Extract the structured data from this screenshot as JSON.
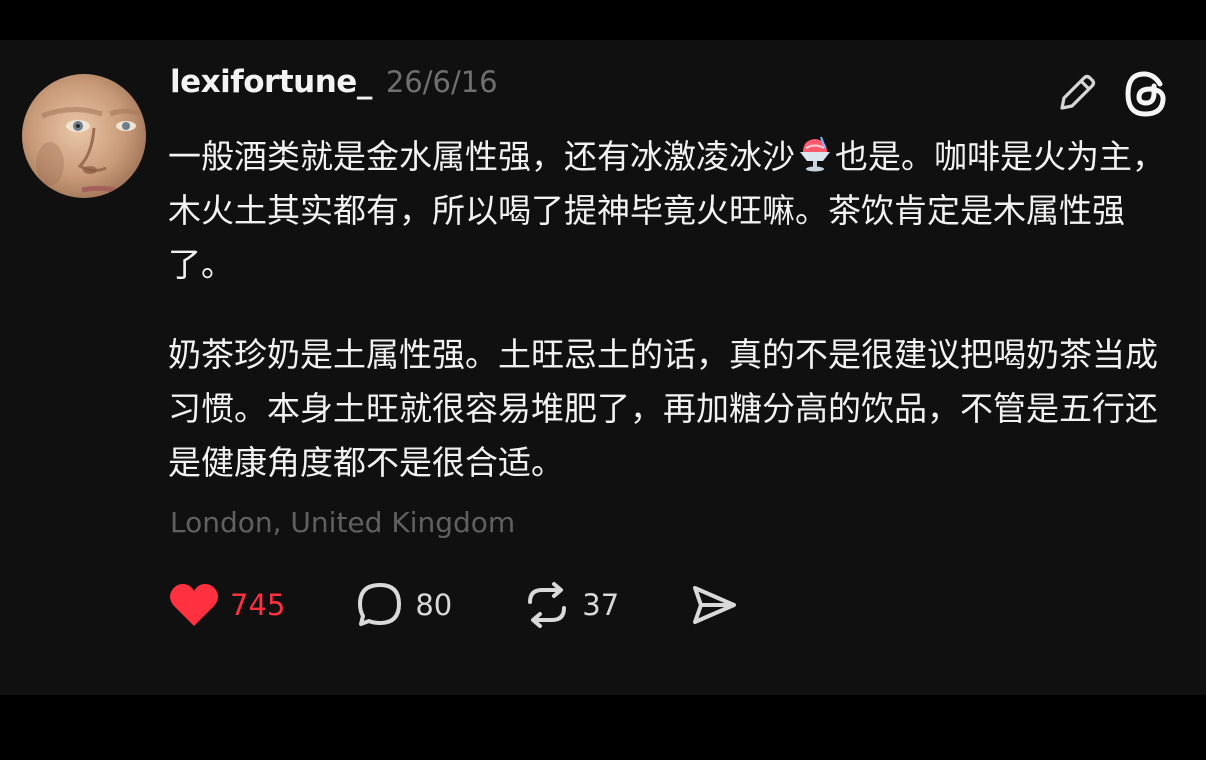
{
  "post": {
    "username": "lexifortune_",
    "timestamp": "26/6/16",
    "paragraph1_part1": "一般酒类就是金水属性强，还有冰激凌冰沙",
    "emoji": "shaved-ice-emoji",
    "paragraph1_part2": "也是。咖啡是火为主，木火土其实都有，所以喝了提神毕竟火旺嘛。茶饮肯定是木属性强了。",
    "paragraph2": "奶茶珍奶是土属性强。土旺忌土的话，真的不是很建议把喝奶茶当成习惯。本身土旺就很容易堆肥了，再加糖分高的饮品，不管是五行还是健康角度都不是很合适。",
    "location": "London, United Kingdom"
  },
  "actions": {
    "likes": "745",
    "comments": "80",
    "reposts": "37",
    "liked": true
  },
  "colors": {
    "background": "#101010",
    "text": "#f2f2f2",
    "muted": "#6f6f6f",
    "like_red": "#ff3040"
  },
  "icons": {
    "edit": "pencil-icon",
    "brand": "threads-logo-icon",
    "like": "heart-icon",
    "comment": "comment-bubble-icon",
    "repost": "repost-icon",
    "share": "send-icon"
  }
}
